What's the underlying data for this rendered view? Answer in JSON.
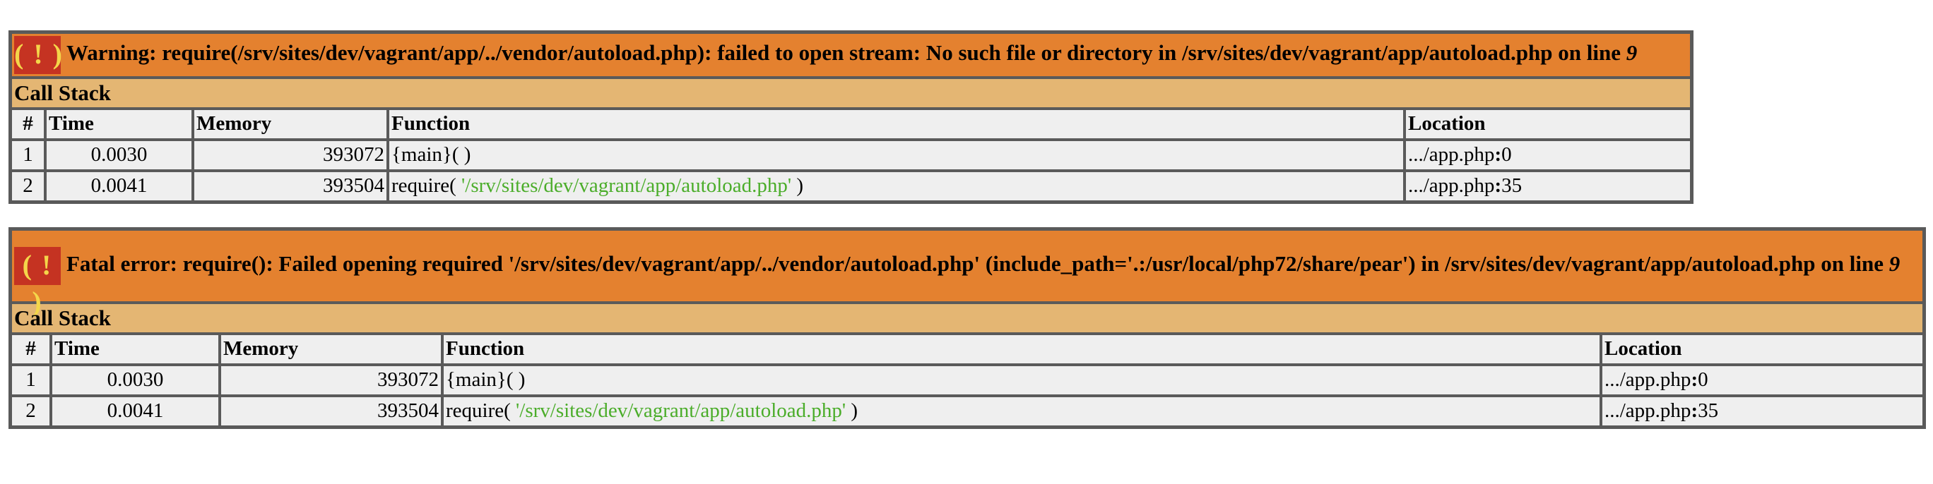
{
  "alert_symbol": "( ! )",
  "errors": [
    {
      "level": "Warning",
      "message": ": require(/srv/sites/dev/vagrant/app/../vendor/autoload.php): failed to open stream: No such file or directory in /srv/sites/dev/vagrant/app/autoload.php on line ",
      "line": "9"
    },
    {
      "level": "Fatal error",
      "message": ": require(): Failed opening required '/srv/sites/dev/vagrant/app/../vendor/autoload.php' (include_path='.:/usr/local/php72/share/pear') in /srv/sites/dev/vagrant/app/autoload.php on line ",
      "line": "9"
    }
  ],
  "call_stack_title": "Call Stack",
  "columns": [
    "#",
    "Time",
    "Memory",
    "Function",
    "Location"
  ],
  "rows": [
    {
      "num": "1",
      "time": "0.0030",
      "memory": "393072",
      "function": "{main}( )",
      "location_file": ".../app.php",
      "location_sep": ":",
      "location_line": "0"
    },
    {
      "num": "2",
      "time": "0.0041",
      "memory": "393504",
      "function_prefix": "require( ",
      "function_arg": "'/srv/sites/dev/vagrant/app/autoload.php'",
      "function_suffix": " )",
      "location_file": ".../app.php",
      "location_sep": ":",
      "location_line": "35"
    }
  ],
  "colors": {
    "error_header": "#e4812f",
    "stack_header": "#e4b673",
    "alert_bg": "#c53322",
    "alert_fg": "#f4d64a",
    "string_arg": "#4bad2a",
    "cell_bg": "#efefef"
  }
}
